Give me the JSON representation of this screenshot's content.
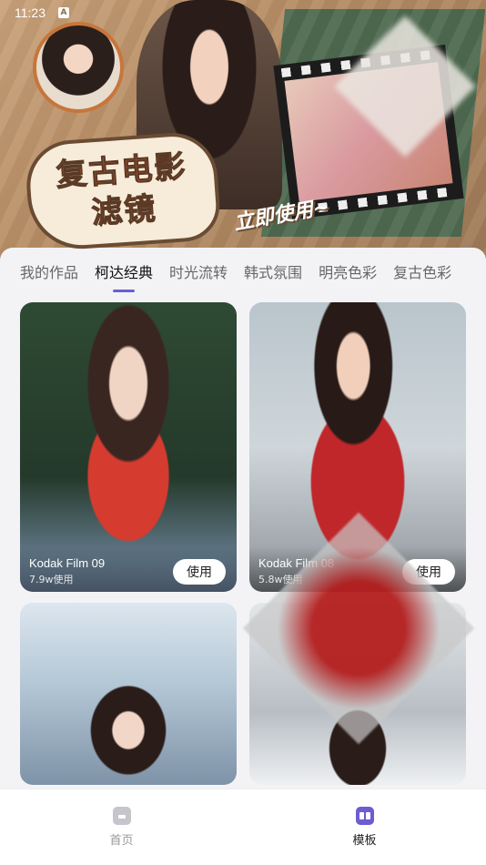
{
  "status_bar": {
    "time": "11:23",
    "notification_icon": "A"
  },
  "banner": {
    "title_line1": "复古电影",
    "title_line2": "滤镜",
    "subtitle": "立即使用~"
  },
  "tabs": [
    {
      "label": "我的作品",
      "active": false
    },
    {
      "label": "柯达经典",
      "active": true
    },
    {
      "label": "时光流转",
      "active": false
    },
    {
      "label": "韩式氛围",
      "active": false
    },
    {
      "label": "明亮色彩",
      "active": false
    },
    {
      "label": "复古色彩",
      "active": false
    }
  ],
  "cards": [
    {
      "title": "Kodak Film 09",
      "usage": "7.9w使用",
      "button": "使用"
    },
    {
      "title": "Kodak Film 08",
      "usage": "5.8w使用",
      "button": "使用"
    }
  ],
  "bottom_nav": {
    "home_label": "首页",
    "template_label": "模板"
  },
  "colors": {
    "accent": "#6d5dd3",
    "background": "#f3f3f6"
  },
  "icons": [
    "home-icon",
    "template-icon",
    "notification-icon"
  ]
}
